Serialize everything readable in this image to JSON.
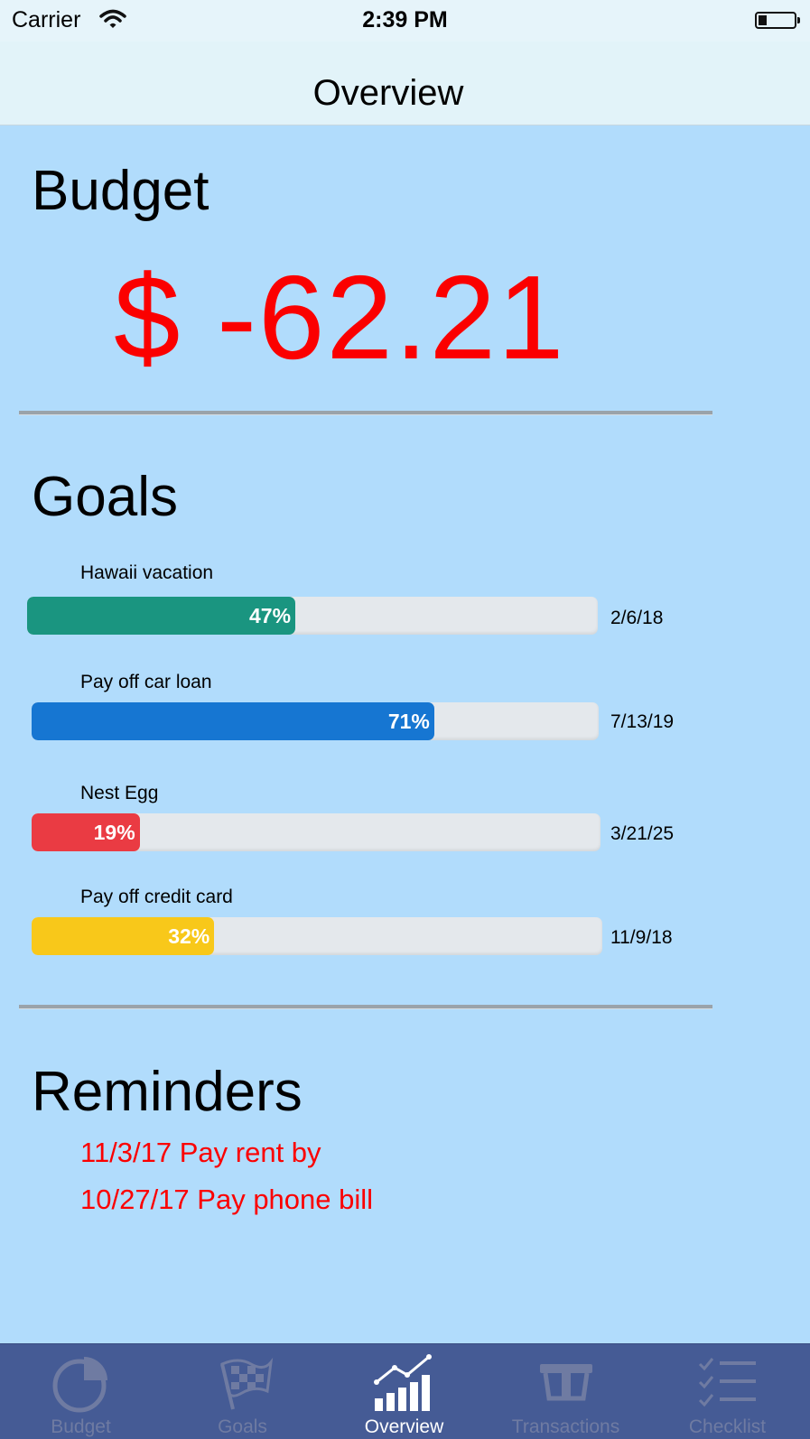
{
  "status": {
    "carrier": "Carrier",
    "time": "2:39 PM"
  },
  "nav": {
    "title": "Overview"
  },
  "budget": {
    "heading": "Budget",
    "amount": "$ -62.21",
    "amount_color": "#fb0000"
  },
  "goals": {
    "heading": "Goals",
    "items": [
      {
        "name": "Hawaii vacation",
        "percent_label": "47%",
        "progress": 0.47,
        "date": "2/6/18",
        "color": "#1a9580"
      },
      {
        "name": "Pay off car loan",
        "percent_label": "71%",
        "progress": 0.71,
        "date": "7/13/19",
        "color": "#1676d2"
      },
      {
        "name": "Nest Egg",
        "percent_label": "19%",
        "progress": 0.19,
        "date": "3/21/25",
        "color": "#ea3b43"
      },
      {
        "name": "Pay off credit card",
        "percent_label": "32%",
        "progress": 0.32,
        "date": "11/9/18",
        "color": "#f8c81a"
      }
    ]
  },
  "reminders": {
    "heading": "Reminders",
    "items": [
      "11/3/17 Pay rent by",
      "10/27/17 Pay phone bill"
    ]
  },
  "tabbar": {
    "active_color": "#ffffff",
    "inactive_color": "#6f7ba2",
    "background": "#455b95",
    "items": [
      {
        "label": "Budget",
        "icon": "pie-chart-icon"
      },
      {
        "label": "Goals",
        "icon": "checkered-flag-icon"
      },
      {
        "label": "Overview",
        "icon": "bar-chart-icon"
      },
      {
        "label": "Transactions",
        "icon": "card-icon"
      },
      {
        "label": "Checklist",
        "icon": "checklist-icon"
      }
    ]
  }
}
